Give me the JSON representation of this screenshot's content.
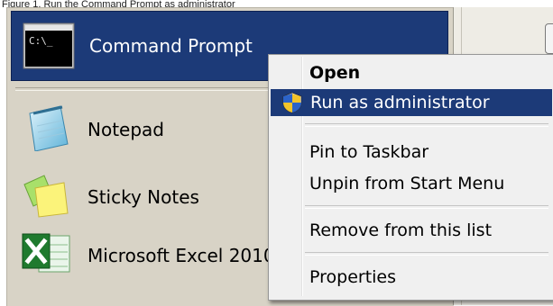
{
  "caption": "Figure 1. Run the Command Prompt as administrator",
  "start_menu": {
    "items": [
      {
        "label": "Command Prompt",
        "icon": "command-prompt-icon",
        "highlighted": true
      },
      {
        "label": "Notepad",
        "icon": "notepad-icon"
      },
      {
        "label": "Sticky Notes",
        "icon": "sticky-notes-icon"
      },
      {
        "label": "Microsoft Excel 2010",
        "icon": "excel-icon"
      }
    ],
    "cmd_icon_text": "C:\\_"
  },
  "context_menu": {
    "items": [
      {
        "label": "Open",
        "bold": true
      },
      {
        "label": "Run as administrator",
        "selected": true,
        "icon": "uac-shield-icon"
      },
      {
        "label": "Pin to Taskbar"
      },
      {
        "label": "Unpin from Start Menu"
      },
      {
        "label": "Remove from this list"
      },
      {
        "label": "Properties"
      }
    ]
  },
  "colors": {
    "highlight": "#1c3a78",
    "menu_background": "#d8d3c6",
    "context_background": "#f0f0f0"
  }
}
